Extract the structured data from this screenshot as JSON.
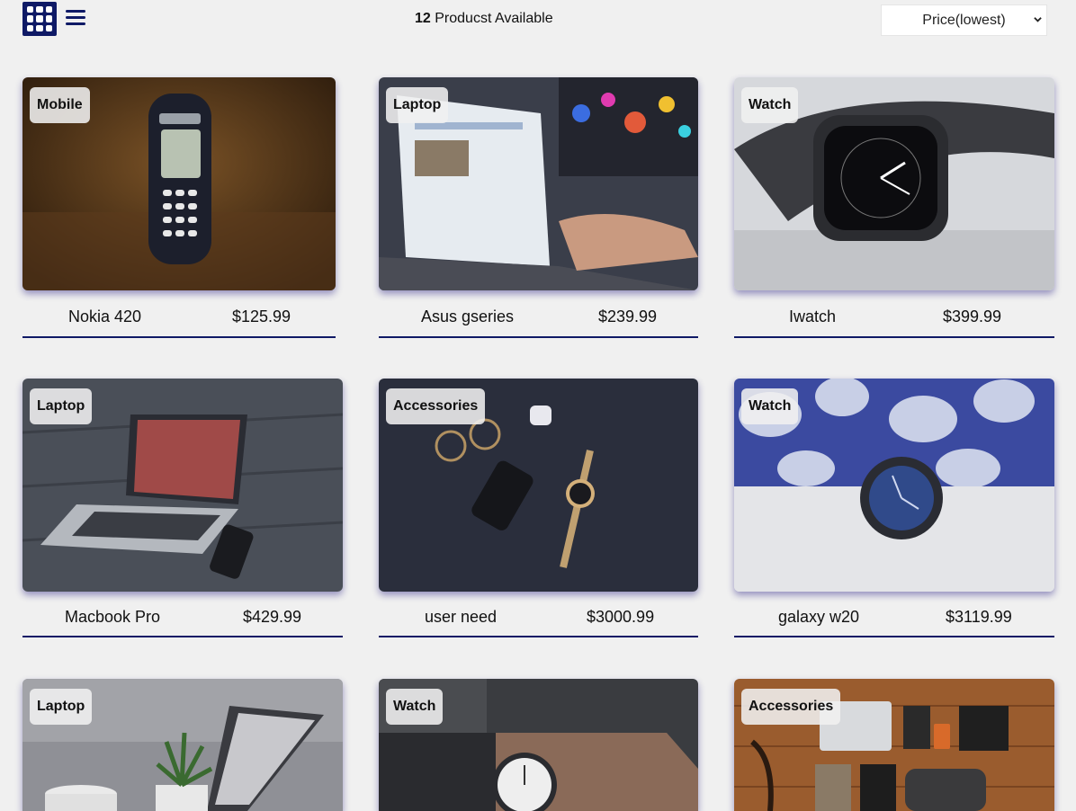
{
  "toolbar": {
    "grid_view_icon": "grid-icon",
    "list_view_icon": "list-icon",
    "count_number": "12",
    "count_label": "Producst Available",
    "sort_selected": "Price(lowest)",
    "accent_color": "#0f1a66"
  },
  "products": [
    {
      "category": "Mobile",
      "name": "Nokia 420",
      "price": "$125.99"
    },
    {
      "category": "Laptop",
      "name": "Asus gseries",
      "price": "$239.99"
    },
    {
      "category": "Watch",
      "name": "Iwatch",
      "price": "$399.99"
    },
    {
      "category": "Laptop",
      "name": "Macbook Pro",
      "price": "$429.99"
    },
    {
      "category": "Accessories",
      "name": "user need",
      "price": "$3000.99"
    },
    {
      "category": "Watch",
      "name": "galaxy w20",
      "price": "$3119.99"
    },
    {
      "category": "Laptop",
      "name": "",
      "price": ""
    },
    {
      "category": "Watch",
      "name": "",
      "price": ""
    },
    {
      "category": "Accessories",
      "name": "",
      "price": ""
    }
  ]
}
